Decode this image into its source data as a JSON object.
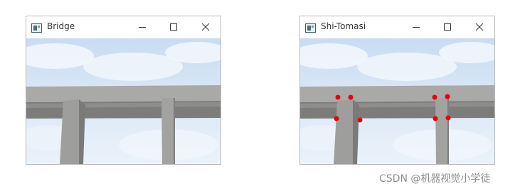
{
  "windows": [
    {
      "title": "Bridge"
    },
    {
      "title": "Shi-Tomasi"
    }
  ],
  "icons": {
    "app": "app-window-icon",
    "minimize": "minimize-icon",
    "maximize": "maximize-icon",
    "close": "close-icon"
  },
  "colors": {
    "sky": "#dce9f7",
    "beam": "#9a9a98",
    "corner_marker": "#e8000b"
  },
  "watermark": "CSDN @机器视觉小学徒"
}
